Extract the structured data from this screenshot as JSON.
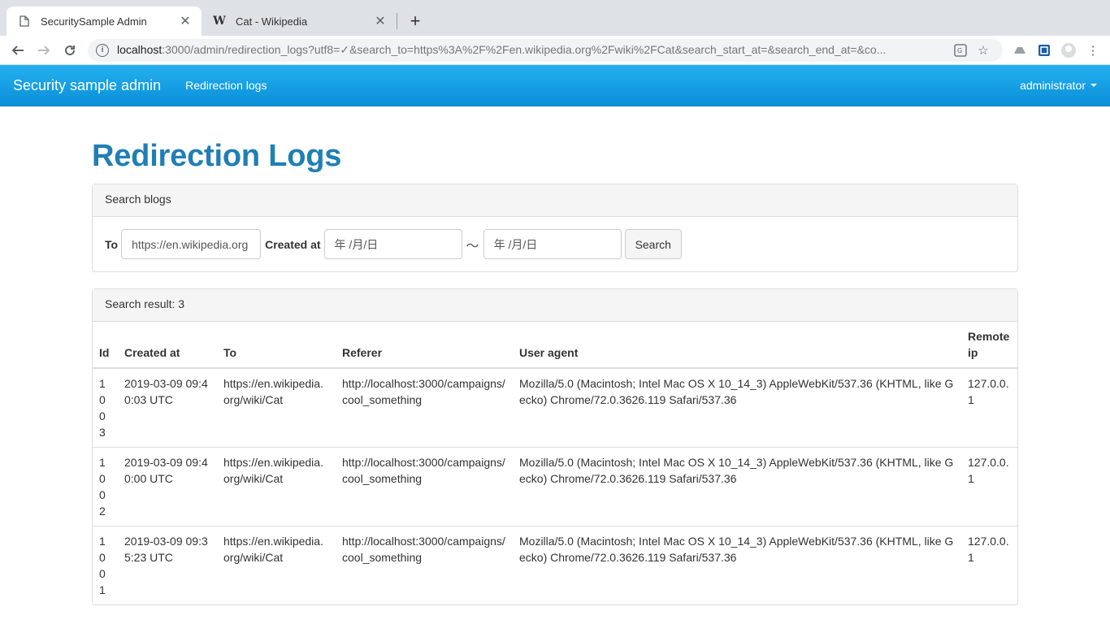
{
  "browser": {
    "tabs": [
      {
        "title": "SecuritySample Admin",
        "active": true,
        "icon": "document-icon"
      },
      {
        "title": "Cat - Wikipedia",
        "active": false,
        "icon": "wikipedia-icon"
      }
    ],
    "url_host": "localhost",
    "url_rest": ":3000/admin/redirection_logs?utf8=✓&search_to=https%3A%2F%2Fen.wikipedia.org%2Fwiki%2FCat&search_start_at=&search_end_at=&co..."
  },
  "navbar": {
    "brand": "Security sample admin",
    "link": "Redirection logs",
    "user": "administrator"
  },
  "page": {
    "title": "Redirection Logs"
  },
  "search": {
    "heading": "Search blogs",
    "to_label": "To",
    "to_value": "https://en.wikipedia.org",
    "created_label": "Created at",
    "date_placeholder_start": "年 /月/日",
    "date_placeholder_end": "年 /月/日",
    "tilde": "〜",
    "button": "Search"
  },
  "results": {
    "heading": "Search result: 3",
    "columns": [
      "Id",
      "Created at",
      "To",
      "Referer",
      "User agent",
      "Remote ip"
    ],
    "rows": [
      {
        "id": "1003",
        "created_at": "2019-03-09 09:40:03 UTC",
        "to": "https://en.wikipedia.org/wiki/Cat",
        "referer": "http://localhost:3000/campaigns/cool_something",
        "user_agent": "Mozilla/5.0 (Macintosh; Intel Mac OS X 10_14_3) AppleWebKit/537.36 (KHTML, like Gecko) Chrome/72.0.3626.119 Safari/537.36",
        "remote_ip": "127.0.0.1"
      },
      {
        "id": "1002",
        "created_at": "2019-03-09 09:40:00 UTC",
        "to": "https://en.wikipedia.org/wiki/Cat",
        "referer": "http://localhost:3000/campaigns/cool_something",
        "user_agent": "Mozilla/5.0 (Macintosh; Intel Mac OS X 10_14_3) AppleWebKit/537.36 (KHTML, like Gecko) Chrome/72.0.3626.119 Safari/537.36",
        "remote_ip": "127.0.0.1"
      },
      {
        "id": "1001",
        "created_at": "2019-03-09 09:35:23 UTC",
        "to": "https://en.wikipedia.org/wiki/Cat",
        "referer": "http://localhost:3000/campaigns/cool_something",
        "user_agent": "Mozilla/5.0 (Macintosh; Intel Mac OS X 10_14_3) AppleWebKit/537.36 (KHTML, like Gecko) Chrome/72.0.3626.119 Safari/537.36",
        "remote_ip": "127.0.0.1"
      }
    ]
  }
}
